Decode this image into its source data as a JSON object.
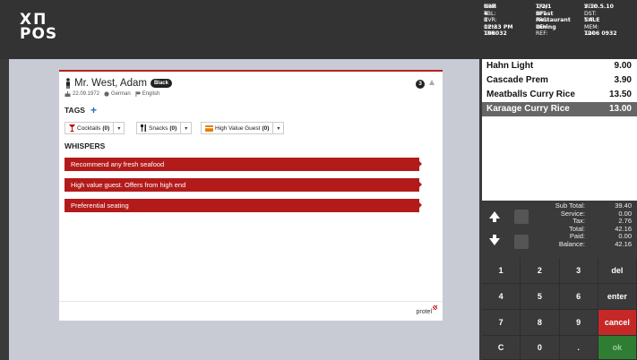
{
  "app": {
    "logo_line1": "XΠ",
    "logo_line2": "POS"
  },
  "info": {
    "rows": [
      {
        "c1": "OPR: ",
        "c1b": "Neil",
        "c2": "TRM: ",
        "c2b": "1/2/1",
        "c3": "VER: ",
        "c3b": "3.10.5.10"
      },
      {
        "c1": "TBL: ",
        "c1b": "4",
        "c2": "SFT: ",
        "c2b": "BFast",
        "c3": "DST: ",
        "c3b": ""
      },
      {
        "c1": "CVR: ",
        "c1b": "3",
        "c2": "PRC: ",
        "c2b": "Restaurant",
        "c3": "TYP: ",
        "c3b": "SALE"
      },
      {
        "c1": "OPN: ",
        "c1b": "12:33 PM",
        "c2": "REV: ",
        "c2b": "Dining",
        "c3": "MEM: ",
        "c3b": ""
      },
      {
        "c1": "TRN: ",
        "c1b": "106032",
        "c2": "REF: ",
        "c2b": "",
        "c3": "TIM: ",
        "c3b": "1206 0932"
      }
    ]
  },
  "guest": {
    "name": "Mr. West, Adam",
    "badge": "Black",
    "count": "3",
    "dob": "22.09.1972",
    "nationality": "German",
    "language": "English"
  },
  "tags": {
    "title": "TAGS",
    "add": "+",
    "buttons": [
      {
        "label": "Cocktails",
        "count": "(0)",
        "icon": "cocktail-icon",
        "color": "#c00000"
      },
      {
        "label": "Snacks",
        "count": "(0)",
        "icon": "cutlery-icon",
        "color": "#222222"
      },
      {
        "label": "High Value Guest",
        "count": "(0)",
        "icon": "card-icon",
        "color": "#e67e00"
      }
    ]
  },
  "whispers": {
    "title": "WHISPERS",
    "items": [
      "Recommend any fresh seafood",
      "High value guest. Offers from high end",
      "Preferential seating"
    ]
  },
  "footer": {
    "brand": "protel"
  },
  "orders": [
    {
      "name": "Hahn Light",
      "price": "9.00",
      "selected": false
    },
    {
      "name": "Cascade Prem",
      "price": "3.90",
      "selected": false
    },
    {
      "name": "Meatballs Curry Rice",
      "price": "13.50",
      "selected": false
    },
    {
      "name": "Karaage Curry Rice",
      "price": "13.00",
      "selected": true
    }
  ],
  "totals": {
    "labels": [
      "Sub Total:",
      "Service:",
      "Tax:",
      "Total:",
      "Paid:",
      "Balance:"
    ],
    "values": [
      "39.40",
      "0.00",
      "2.76",
      "42.16",
      "0.00",
      "42.16"
    ]
  },
  "keypad": [
    "1",
    "2",
    "3",
    "del",
    "4",
    "5",
    "6",
    "enter",
    "7",
    "8",
    "9",
    "cancel",
    "C",
    "0",
    ".",
    "ok"
  ],
  "colors": {
    "accent_red": "#b31b1b",
    "cancel": "#c62828",
    "ok": "#2e7d32",
    "selected_row": "#666666"
  }
}
